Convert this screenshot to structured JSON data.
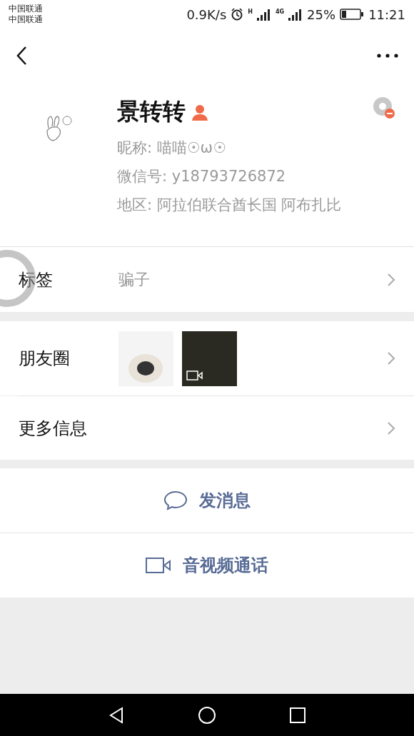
{
  "status_bar": {
    "carriers": [
      "中国联通",
      "中国联通"
    ],
    "speed": "0.9K/s",
    "network_1": "H",
    "network_2": "4G",
    "battery_text": "25%",
    "battery": {
      "level": 0.25
    },
    "time": "11:21"
  },
  "profile": {
    "name": "景转转",
    "nickname": "昵称: 喵喵☉ω☉",
    "wechat_id": "微信号: y18793726872",
    "region": "地区: 阿拉伯联合酋长国  阿布扎比"
  },
  "rows": [
    {
      "kind": "text",
      "label": "标签",
      "value": "骗子"
    }
  ],
  "rows_2": [
    {
      "kind": "photos",
      "label": "朋友圈"
    },
    {
      "kind": "plain",
      "label": "更多信息"
    }
  ],
  "actions": [
    {
      "kind": "message",
      "label": "发消息"
    },
    {
      "kind": "video",
      "label": "音视频通话"
    }
  ]
}
